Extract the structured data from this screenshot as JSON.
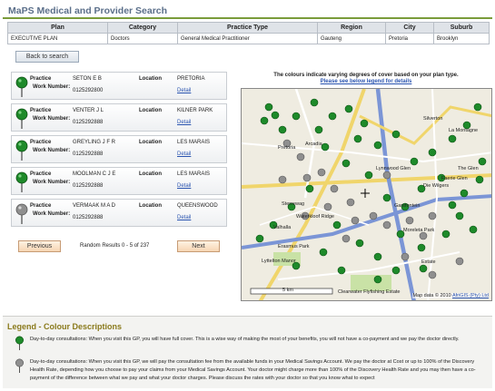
{
  "page": {
    "title": "MaPS Medical and Provider Search"
  },
  "criteria": {
    "headers": [
      "Plan",
      "Category",
      "Practice Type",
      "Region",
      "City",
      "Suburb"
    ],
    "values": [
      "EXECUTIVE PLAN",
      "Doctors",
      "General Medical Practitioner",
      "Gauteng",
      "Pretoria",
      "Brooklyn"
    ]
  },
  "back_button": "Back to search",
  "labels": {
    "practice": "Practice",
    "work_number": "Work Number:",
    "location": "Location",
    "detail": "Detail"
  },
  "results": [
    {
      "name": "SETON E B",
      "number": "0125292800",
      "suburb": "PRETORIA",
      "pin": "green"
    },
    {
      "name": "VENTER J L",
      "number": "0125292888",
      "suburb": "KILNER PARK",
      "pin": "green"
    },
    {
      "name": "GREYLING J F R",
      "number": "0125292888",
      "suburb": "LES MARAIS",
      "pin": "green"
    },
    {
      "name": "MOOLMAN C J E",
      "number": "0125292888",
      "suburb": "LES MARAIS",
      "pin": "green"
    },
    {
      "name": "VERMAAK M A D",
      "number": "0125292888",
      "suburb": "QUEENSWOOD",
      "pin": "gray"
    }
  ],
  "pager": {
    "previous": "Previous",
    "next": "Next",
    "summary": "Random Results 0 - 5 of 237"
  },
  "map": {
    "intro": "The colours indicate varying degrees of cover based on your plan type.",
    "intro_link": "Please see below legend for details",
    "scale": "5 km",
    "copyright": "Map data © 2010",
    "copyright_link": "AfriGIS (Pty) Ltd",
    "places": [
      "Pretoria",
      "Waterkloof Ridge",
      "Lynnwood Glen",
      "Erasmus Park",
      "Lyttelton Manor",
      "Clearwater Flyfishing Estate",
      "The Glen",
      "Garsfontein",
      "Moreleta Park",
      "La Montagne",
      "Sterrewag",
      "Arcadia",
      "Silverton",
      "Die Wilgers",
      "Valhalla",
      "Estate",
      "Faerie Glen"
    ]
  },
  "legend": {
    "title": "Legend - Colour Descriptions",
    "items": [
      {
        "pin": "green",
        "text": "Day-to-day consultations: When you visit this GP, you will have full cover. This is a wise way of making the most of your benefits, you will not have a co-payment and we pay the doctor directly."
      },
      {
        "pin": "gray",
        "text": "Day-to-day consultations: When you visit this GP, we will pay the consultation fee from the available funds in your Medical Savings Account. We pay the doctor at Cost or up to 100% of the Discovery Health Rate, depending how you choose to pay your claims from your Medical Savings Account. Your doctor might charge more than 100% of the Discovery Health Rate and you may then have a co-payment of the difference between what we pay and what your doctor charges. Please discuss the rates with your doctor so that you know what to expect"
      }
    ]
  },
  "colors": {
    "pin_green": "#1e8a2a",
    "pin_gray": "#8f8f8f",
    "title": "#5b6f8a",
    "legend_title": "#8a7a1c",
    "link": "#2a54b0"
  }
}
